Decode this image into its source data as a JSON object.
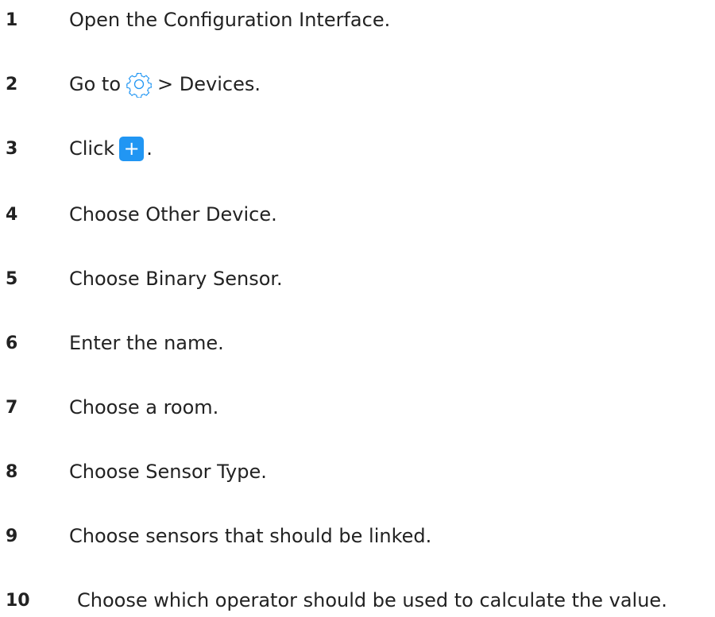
{
  "steps": [
    {
      "number": "1",
      "text": "Open the Configuration Interface."
    },
    {
      "number": "2",
      "before": "Go to",
      "icon": "gear-icon",
      "after": "> Devices."
    },
    {
      "number": "3",
      "before": "Click",
      "icon": "plus-icon",
      "button_symbol": "+",
      "after": "."
    },
    {
      "number": "4",
      "text": "Choose Other Device."
    },
    {
      "number": "5",
      "text": "Choose Binary Sensor."
    },
    {
      "number": "6",
      "text": "Enter the name."
    },
    {
      "number": "7",
      "text": "Choose a room."
    },
    {
      "number": "8",
      "text": "Choose Sensor Type."
    },
    {
      "number": "9",
      "text": "Choose sensors that should be linked."
    },
    {
      "number": "10",
      "text": "Choose which operator should be used to calculate the value."
    }
  ],
  "colors": {
    "accent": "#2196f3",
    "text": "#222222"
  }
}
